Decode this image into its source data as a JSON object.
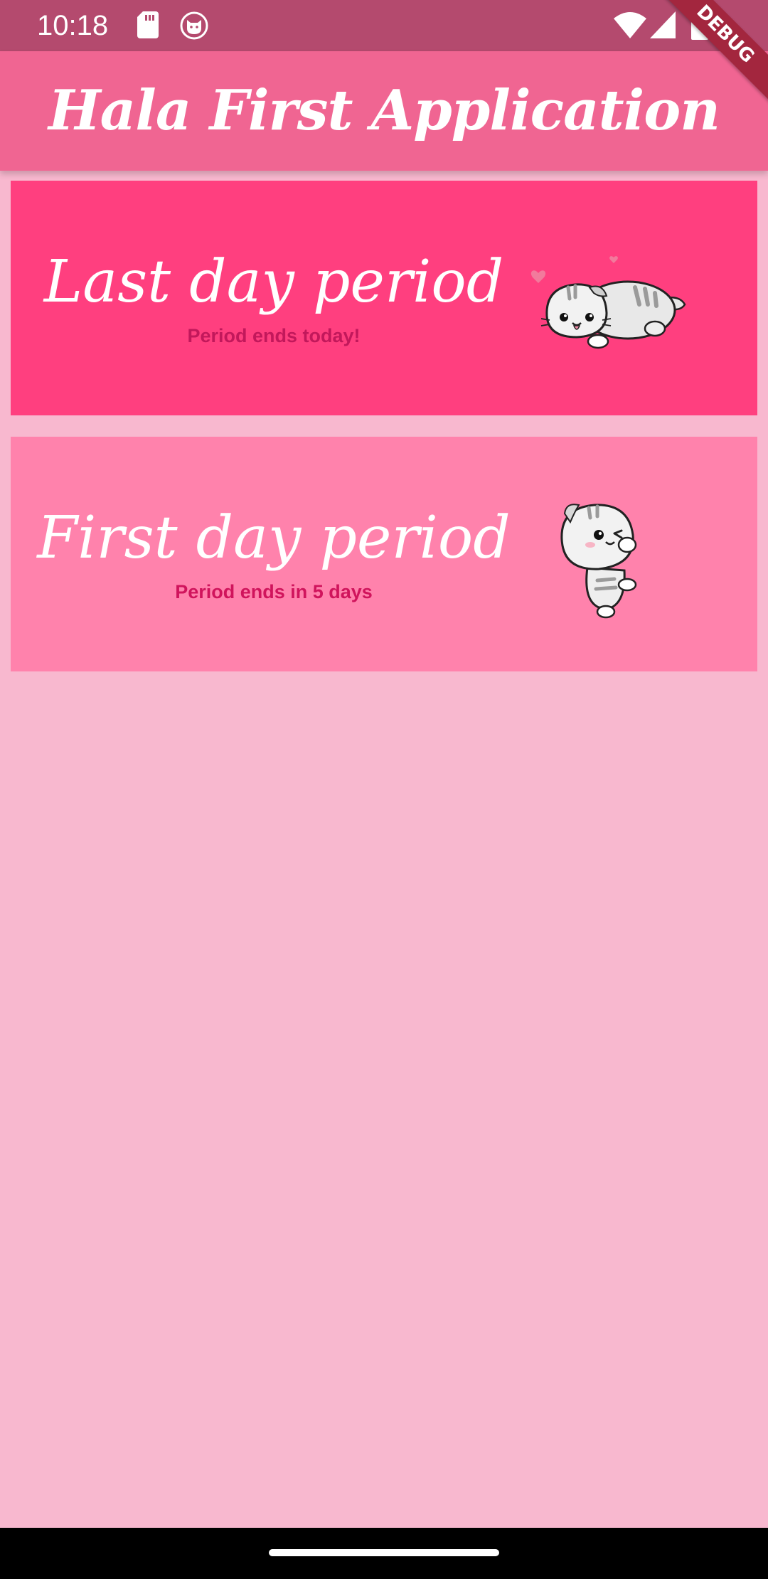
{
  "status_bar": {
    "time": "10:18",
    "icons": [
      "sd-card-icon",
      "cat-notification-icon",
      "wifi-icon",
      "signal-icon",
      "battery-icon"
    ]
  },
  "debug_banner": {
    "label": "DEBUG"
  },
  "app_bar": {
    "title": "Hala First Application"
  },
  "cards": [
    {
      "title": "Last day period",
      "subtitle": "Period ends today!",
      "illustration": "cat-lying-hearts-illustration",
      "background": "#FF3F7F"
    },
    {
      "title": "First day period",
      "subtitle": "Period ends in 5 days",
      "illustration": "cat-winking-illustration",
      "background": "#FF82AC"
    }
  ],
  "colors": {
    "status_bar": "#B44A6E",
    "app_bar": "#F06592",
    "page_background": "#F8B8CF",
    "subtitle_text": "#D81B60",
    "debug_banner": "#A3263E"
  }
}
